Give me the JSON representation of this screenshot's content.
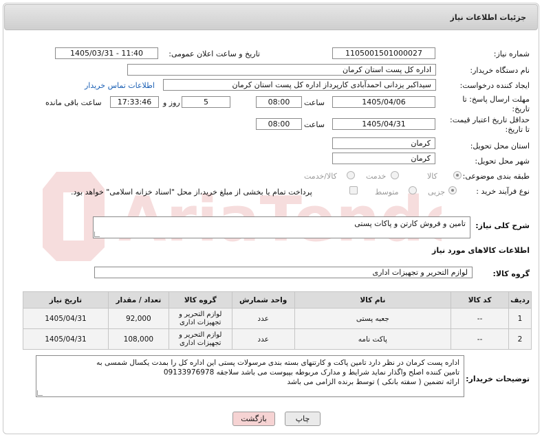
{
  "header": {
    "title": "جزئیات اطلاعات نیاز"
  },
  "fields": {
    "need_number_label": "شماره نیاز:",
    "need_number": "1105001501000027",
    "announce_label": "تاریخ و ساعت اعلان عمومی:",
    "announce_value": "1405/03/31 - 11:40",
    "buyer_label": "نام دستگاه خریدار:",
    "buyer_value": "اداره کل پست استان کرمان",
    "requester_label": "ایجاد کننده درخواست:",
    "requester_value": "سیداکبر یزدانی احمدآبادی کارپرداز اداره کل پست استان کرمان",
    "contact_link": "اطلاعات تماس خریدار",
    "deadline_label_1": "مهلت ارسال پاسخ: تا",
    "deadline_label_2": "تاریخ:",
    "deadline_date": "1405/04/06",
    "time_label": "ساعت",
    "deadline_time": "08:00",
    "days_value": "5",
    "days_label": "روز و",
    "remaining_time": "17:33:46",
    "remaining_label": "ساعت باقی مانده",
    "price_label_1": "حداقل تاریخ اعتبار قیمت:",
    "price_label_2": "تا تاریخ:",
    "price_date": "1405/04/31",
    "price_time": "08:00",
    "province_label": "استان محل تحویل:",
    "province_value": "کرمان",
    "city_label": "شهر محل تحویل:",
    "city_value": "کرمان",
    "category_label": "طبقه بندی موضوعی:",
    "category_options": [
      "کالا",
      "خدمت",
      "کالا/خدمت"
    ],
    "process_label": "نوع فرآیند خرید :",
    "process_options": [
      "جزیی",
      "متوسط"
    ],
    "payment_note": "پرداخت تمام یا بخشی از مبلغ خرید،از محل \"اسناد خزانه اسلامی\" خواهد بود.",
    "desc_label": "شرح کلی نیاز:",
    "desc_value": "تامین و فروش کارتن و پاکات پستی",
    "goods_info_title": "اطلاعات کالاهای مورد نیاز",
    "goods_group_label": "گروه کالا:",
    "goods_group_value": "لوازم التحریر و تجهیزات اداری",
    "buyer_notes_label": "توضیحات خریدار:",
    "buyer_notes_lines": [
      "اداره پست  کرمان در نظر دارد تامین پاکت و کارتنهای بسته بندی مرسولات پستی این اداره کل را بمدت یکسال شمسی به",
      "تامین کننده اصلح واگذار نماید شرایط و مدارک مربوطه بپیوست می باشد  سلاجقه 09133976978",
      "ارائه تضمین ( سفته بانکی ) توسط برنده الزامی می باشد"
    ]
  },
  "table": {
    "headers": [
      "ردیف",
      "کد کالا",
      "نام کالا",
      "واحد شمارش",
      "گروه کالا",
      "تعداد / مقدار",
      "تاریخ نیاز"
    ],
    "rows": [
      [
        "1",
        "--",
        "جعبه پستی",
        "عدد",
        "لوازم التحریر و تجهیزات اداری",
        "92,000",
        "1405/04/31"
      ],
      [
        "2",
        "--",
        "پاکت نامه",
        "عدد",
        "لوازم التحریر و تجهیزات اداری",
        "108,000",
        "1405/04/31"
      ]
    ]
  },
  "buttons": {
    "print": "چاپ",
    "back": "بازگشت"
  },
  "watermark_text": "AriaTender.neT",
  "colors": {
    "link": "#1a5fb4",
    "back_button": "#f6d3d3",
    "print_button": "#eaeaea"
  }
}
